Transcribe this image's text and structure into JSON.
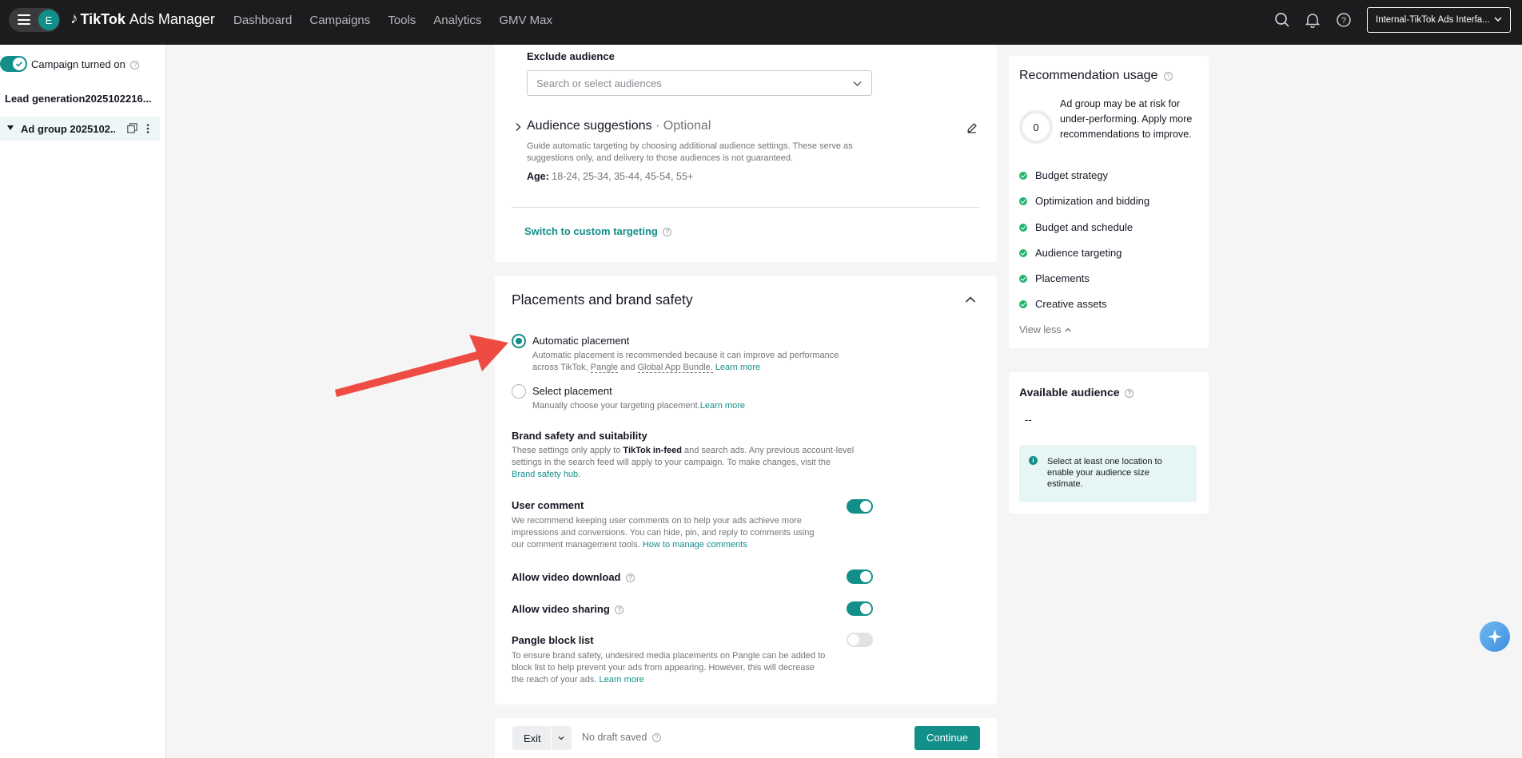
{
  "topbar": {
    "avatar_letter": "E",
    "brand_tiktok": "TikTok",
    "brand_ads": "Ads Manager",
    "nav": [
      "Dashboard",
      "Campaigns",
      "Tools",
      "Analytics",
      "GMV Max"
    ],
    "account": "Internal-TikTok Ads Interfa..."
  },
  "sidebar": {
    "campaign_status": "Campaign turned on",
    "campaign_name": "Lead generation2025102216...",
    "ad_group_name": "Ad group 2025102..."
  },
  "audience": {
    "exclude_label": "Exclude audience",
    "exclude_placeholder": "Search or select audiences",
    "suggestions_title": "Audience suggestions",
    "suggestions_optional": "· Optional",
    "suggestions_desc": "Guide automatic targeting by choosing additional audience settings. These serve as suggestions only, and delivery to those audiences is not guaranteed.",
    "age_label": "Age:",
    "age_value": "18-24, 25-34, 35-44, 45-54, 55+",
    "switch_link": "Switch to custom targeting"
  },
  "placements": {
    "title": "Placements and brand safety",
    "auto_label": "Automatic placement",
    "auto_desc_1": "Automatic placement is recommended because it can improve ad performance",
    "auto_desc_2_prefix": "across TikTok,",
    "auto_desc_pangle": "Pangle",
    "auto_desc_and": "and",
    "auto_desc_gab": "Global App Bundle.",
    "auto_learn": "Learn more",
    "select_label": "Select placement",
    "select_desc": "Manually choose your targeting placement.",
    "select_learn": "Learn more",
    "brand_title": "Brand safety and suitability",
    "brand_desc_1a": "These settings only apply to",
    "brand_desc_1b": "TikTok in-feed",
    "brand_desc_1c": "and search ads. Any previous account-level",
    "brand_desc_2": "settings in the search feed will apply to your campaign. To make changes, visit the",
    "brand_link": "Brand safety hub.",
    "comment_title": "User comment",
    "comment_desc_1": "We recommend keeping user comments on to help your ads achieve more",
    "comment_desc_2": "impressions and conversions. You can hide, pin, and reply to comments using",
    "comment_desc_3": "our comment management tools.",
    "comment_link": "How to manage comments",
    "download_title": "Allow video download",
    "sharing_title": "Allow video sharing",
    "pangle_title": "Pangle block list",
    "pangle_desc_1": "To ensure brand safety, undesired media placements on Pangle can be added to",
    "pangle_desc_2": "block list to help prevent your ads from appearing. However, this will decrease",
    "pangle_desc_3": "the reach of your ads.",
    "pangle_learn": "Learn more"
  },
  "footer": {
    "exit": "Exit",
    "draft": "No draft saved",
    "continue": "Continue"
  },
  "recommendation": {
    "title": "Recommendation usage",
    "score": "0",
    "desc": "Ad group may be at risk for under-performing. Apply more recommendations to improve.",
    "items": [
      "Budget strategy",
      "Optimization and bidding",
      "Budget and schedule",
      "Audience targeting",
      "Placements",
      "Creative assets"
    ],
    "view_less": "View less"
  },
  "available_audience": {
    "title": "Available audience",
    "value": "--",
    "info": "Select at least one location to enable your audience size estimate."
  },
  "colors": {
    "accent": "#138f8a",
    "topbar": "#1c1c1e",
    "annotation_arrow": "#ee4c43"
  }
}
